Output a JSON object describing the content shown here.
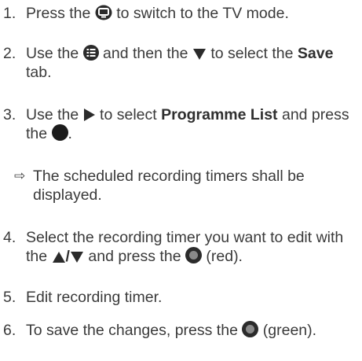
{
  "steps": [
    {
      "number": "1.",
      "parts": {
        "a": "Press the",
        "b": "to switch to the TV mode."
      },
      "icon": "tv-mode-button-icon"
    },
    {
      "number": "2.",
      "parts": {
        "a": "Use the",
        "b": "and then the",
        "c": "to select the",
        "bold": "Save",
        "d": "tab."
      },
      "icons": [
        "menu-button-icon",
        "down-arrow-button-icon"
      ]
    },
    {
      "number": "3.",
      "parts": {
        "a": "Use the",
        "b": "to select",
        "bold": "Programme List",
        "c": "and press the",
        "d": "."
      },
      "icons": [
        "right-arrow-button-icon",
        "ok-button-icon"
      ]
    },
    {
      "result": "The scheduled recording timers shall be displayed.",
      "arrow": "⇨"
    },
    {
      "number": "4.",
      "parts": {
        "a": "Select the recording timer you want to edit with the",
        "slash": "/",
        "b": "and press the",
        "c": "(red)."
      },
      "icons": [
        "up-arrow-icon",
        "down-arrow-icon",
        "red-button-icon"
      ]
    },
    {
      "number": "5.",
      "parts": {
        "a": "Edit recording timer."
      }
    },
    {
      "number": "6.",
      "parts": {
        "a": "To save the changes, press the",
        "b": "(green)."
      },
      "icons": [
        "green-button-icon"
      ]
    }
  ],
  "colors": {
    "text": "#3a3a3a",
    "icon": "#2b2b2b",
    "colored_button_inner": "#8a8a8a"
  }
}
